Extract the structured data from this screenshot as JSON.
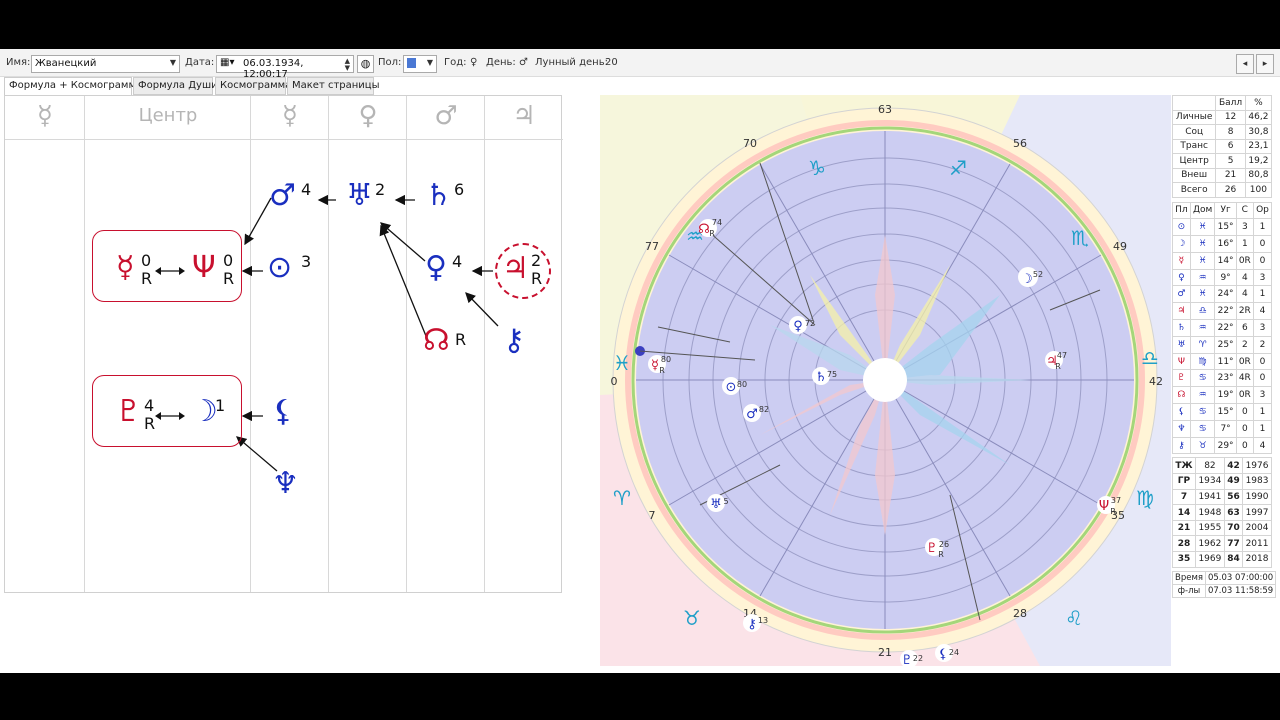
{
  "toolbar": {
    "name_label": "Имя:",
    "name_value": "Жванецкий",
    "date_label": "Дата:",
    "date_value": "06.03.1934, 12:00:17",
    "sex_label": "Пол:",
    "year_label": "Год:",
    "year_value": "♀",
    "day_label": "День:",
    "day_value": "♂",
    "lunar_label": "Лунный день:",
    "lunar_value": "20",
    "nav_prev": "◂",
    "nav_next": "▸"
  },
  "tabs": [
    {
      "label": "Формула + Космограмма",
      "active": true
    },
    {
      "label": "Формула Души",
      "active": false
    },
    {
      "label": "Космограмма",
      "active": false
    },
    {
      "label": "Макет страницы",
      "active": false
    }
  ],
  "formula": {
    "headers": [
      "☿",
      "Центр",
      "☿",
      "♀",
      "♂",
      "♃"
    ],
    "mercury": "☿",
    "mercury_n": "0",
    "mercury_r": "R",
    "neptune": "Ψ",
    "neptune_n": "0",
    "neptune_r": "R",
    "sun": "⊙",
    "sun_n": "3",
    "mars": "♂",
    "mars_n": "4",
    "uranus": "♅",
    "uranus_n": "2",
    "saturn": "♄",
    "saturn_n": "6",
    "venus": "♀",
    "venus_n": "4",
    "jupiter": "♃",
    "jupiter_n": "2",
    "jupiter_r": "R",
    "node": "☊",
    "node_r": "R",
    "chiron": "⚷",
    "pluto": "♇",
    "pluto_n": "4",
    "pluto_r": "R",
    "moon": "☽",
    "moon_n": "1",
    "lilith": "⚸",
    "selena": "♆",
    "arrow_double": "↔"
  },
  "chart": {
    "degree_labels": [
      "63",
      "56",
      "49",
      "42",
      "35",
      "28",
      "21",
      "14",
      "7",
      "0",
      "77",
      "70"
    ],
    "zodiac": [
      "♑",
      "♐",
      "♏",
      "♎",
      "♍",
      "♌",
      "♋",
      "♊",
      "♉",
      "♈",
      "♓",
      "♒"
    ],
    "planets": [
      {
        "sym": "☊",
        "n": "74",
        "r": "R"
      },
      {
        "sym": "♀",
        "n": "72"
      },
      {
        "sym": "♄",
        "n": "75"
      },
      {
        "sym": "☿",
        "n": "80",
        "r": "R"
      },
      {
        "sym": "⊙",
        "n": "80"
      },
      {
        "sym": "♂",
        "n": "82"
      },
      {
        "sym": "☽",
        "n": "52"
      },
      {
        "sym": "♃",
        "n": "47",
        "r": "R"
      },
      {
        "sym": "♅",
        "n": "5"
      },
      {
        "sym": "Ψ",
        "n": "37",
        "r": "R"
      },
      {
        "sym": "♇",
        "n": "26",
        "r": "R"
      },
      {
        "sym": "⚷",
        "n": "13"
      },
      {
        "sym": "♇",
        "n": "22"
      },
      {
        "sym": "⚸",
        "n": "24"
      }
    ]
  },
  "stats": {
    "head": [
      "",
      "Балл",
      "%"
    ],
    "rows": [
      [
        "Личные",
        "12",
        "46,2"
      ],
      [
        "Соц",
        "8",
        "30,8"
      ],
      [
        "Транс",
        "6",
        "23,1"
      ],
      [
        "Центр",
        "5",
        "19,2"
      ],
      [
        "Внеш",
        "21",
        "80,8"
      ],
      [
        "Всего",
        "26",
        "100"
      ]
    ],
    "planet_head": [
      "Пл",
      "Дом",
      "Уг",
      "С",
      "Ор"
    ],
    "planet_rows": [
      [
        "⊙",
        "♓",
        "15°",
        "3",
        "1"
      ],
      [
        "☽",
        "♓",
        "16°",
        "1",
        "0"
      ],
      [
        "☿",
        "♓",
        "14°",
        "0R",
        "0"
      ],
      [
        "♀",
        "♒",
        "9°",
        "4",
        "3"
      ],
      [
        "♂",
        "♓",
        "24°",
        "4",
        "1"
      ],
      [
        "♃",
        "♎",
        "22°",
        "2R",
        "4"
      ],
      [
        "♄",
        "♒",
        "22°",
        "6",
        "3"
      ],
      [
        "♅",
        "♈",
        "25°",
        "2",
        "2"
      ],
      [
        "Ψ",
        "♍",
        "11°",
        "0R",
        "0"
      ],
      [
        "♇",
        "♋",
        "23°",
        "4R",
        "0"
      ],
      [
        "☊",
        "♒",
        "19°",
        "0R",
        "3"
      ],
      [
        "⚸",
        "♋",
        "15°",
        "0",
        "1"
      ],
      [
        "♆",
        "♋",
        "7°",
        "0",
        "1"
      ],
      [
        "⚷",
        "♉",
        "29°",
        "0",
        "4"
      ]
    ],
    "age_rows": [
      [
        "ТЖ",
        "82",
        "42",
        "1976"
      ],
      [
        "ГР",
        "1934",
        "49",
        "1983"
      ],
      [
        "7",
        "1941",
        "56",
        "1990"
      ],
      [
        "14",
        "1948",
        "63",
        "1997"
      ],
      [
        "21",
        "1955",
        "70",
        "2004"
      ],
      [
        "28",
        "1962",
        "77",
        "2011"
      ],
      [
        "35",
        "1969",
        "84",
        "2018"
      ]
    ],
    "time_rows": [
      [
        "Время",
        "05.03 07:00:00"
      ],
      [
        "ф-лы",
        "07.03 11:58:59"
      ]
    ]
  }
}
